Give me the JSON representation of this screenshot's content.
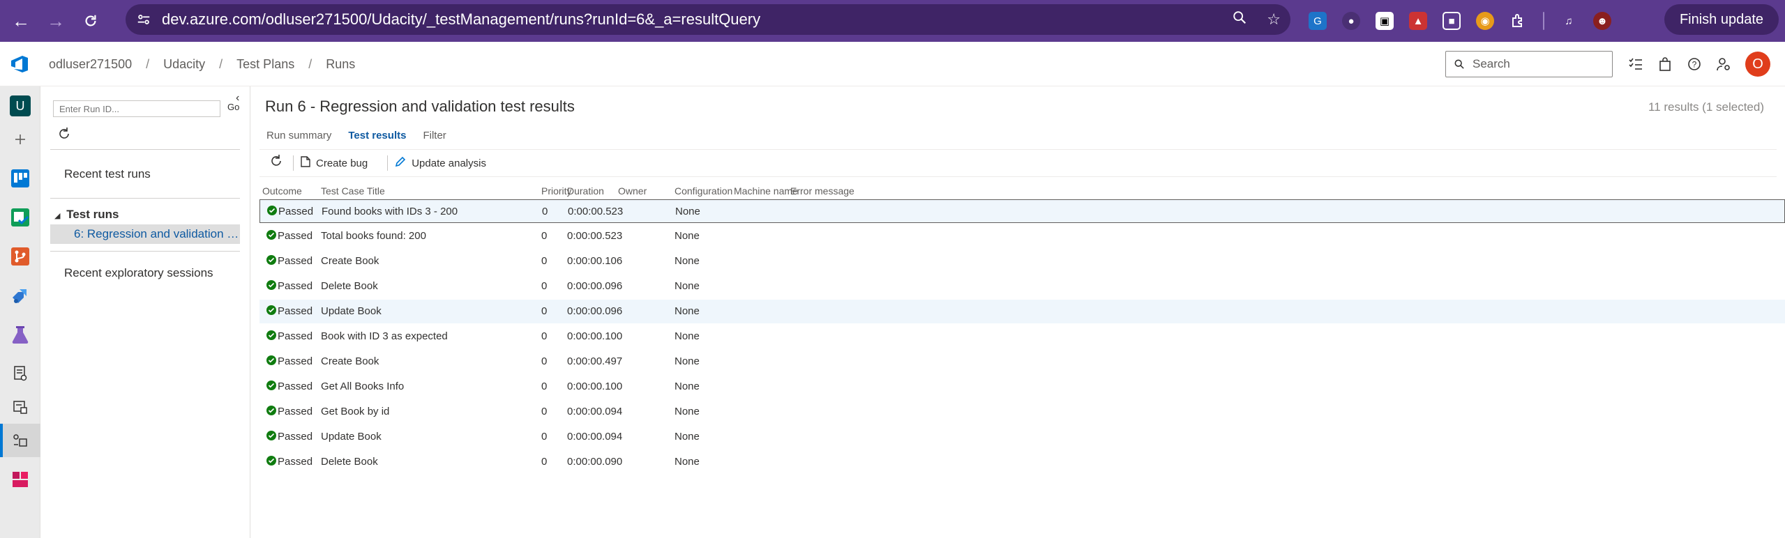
{
  "browser": {
    "url": "dev.azure.com/odluser271500/Udacity/_testManagement/runs?runId=6&_a=resultQuery",
    "finish_update": "Finish update"
  },
  "header": {
    "breadcrumb": [
      "odluser271500",
      "Udacity",
      "Test Plans",
      "Runs"
    ],
    "search_placeholder": "Search",
    "avatar_initial": "O"
  },
  "rail": {
    "project_initial": "U"
  },
  "subnav": {
    "run_id_placeholder": "Enter Run ID...",
    "go_label": "Go",
    "recent_test_runs": "Recent test runs",
    "test_runs_group": "Test runs",
    "selected_run": "6: Regression and validation test results",
    "recent_exploratory": "Recent exploratory sessions"
  },
  "main": {
    "title": "Run 6 - Regression and validation test results",
    "result_count": "11 results (1 selected)",
    "tabs": [
      "Run summary",
      "Test results",
      "Filter"
    ],
    "active_tab": "Test results",
    "toolbar": {
      "create_bug": "Create bug",
      "update_analysis": "Update analysis"
    },
    "columns": [
      "Outcome",
      "Test Case Title",
      "Priority",
      "Duration",
      "Owner",
      "Configuration",
      "Machine name",
      "Error message"
    ],
    "rows": [
      {
        "outcome": "Passed",
        "title": "Found books with IDs 3 - 200",
        "priority": "0",
        "duration": "0:00:00.523",
        "owner": "",
        "configuration": "None"
      },
      {
        "outcome": "Passed",
        "title": "Total books found: 200",
        "priority": "0",
        "duration": "0:00:00.523",
        "owner": "",
        "configuration": "None"
      },
      {
        "outcome": "Passed",
        "title": "Create Book",
        "priority": "0",
        "duration": "0:00:00.106",
        "owner": "",
        "configuration": "None"
      },
      {
        "outcome": "Passed",
        "title": "Delete Book",
        "priority": "0",
        "duration": "0:00:00.096",
        "owner": "",
        "configuration": "None"
      },
      {
        "outcome": "Passed",
        "title": "Update Book",
        "priority": "0",
        "duration": "0:00:00.096",
        "owner": "",
        "configuration": "None"
      },
      {
        "outcome": "Passed",
        "title": "Book with ID 3 as expected",
        "priority": "0",
        "duration": "0:00:00.100",
        "owner": "",
        "configuration": "None"
      },
      {
        "outcome": "Passed",
        "title": "Create Book",
        "priority": "0",
        "duration": "0:00:00.497",
        "owner": "",
        "configuration": "None"
      },
      {
        "outcome": "Passed",
        "title": "Get All Books Info",
        "priority": "0",
        "duration": "0:00:00.100",
        "owner": "",
        "configuration": "None"
      },
      {
        "outcome": "Passed",
        "title": "Get Book by id",
        "priority": "0",
        "duration": "0:00:00.094",
        "owner": "",
        "configuration": "None"
      },
      {
        "outcome": "Passed",
        "title": "Update Book",
        "priority": "0",
        "duration": "0:00:00.094",
        "owner": "",
        "configuration": "None"
      },
      {
        "outcome": "Passed",
        "title": "Delete Book",
        "priority": "0",
        "duration": "0:00:00.090",
        "owner": "",
        "configuration": "None"
      }
    ]
  },
  "colors": {
    "chrome_bg": "#5b3a8e",
    "accent": "#0078d4",
    "passed": "#107c10",
    "avatar": "#e03d1b"
  }
}
